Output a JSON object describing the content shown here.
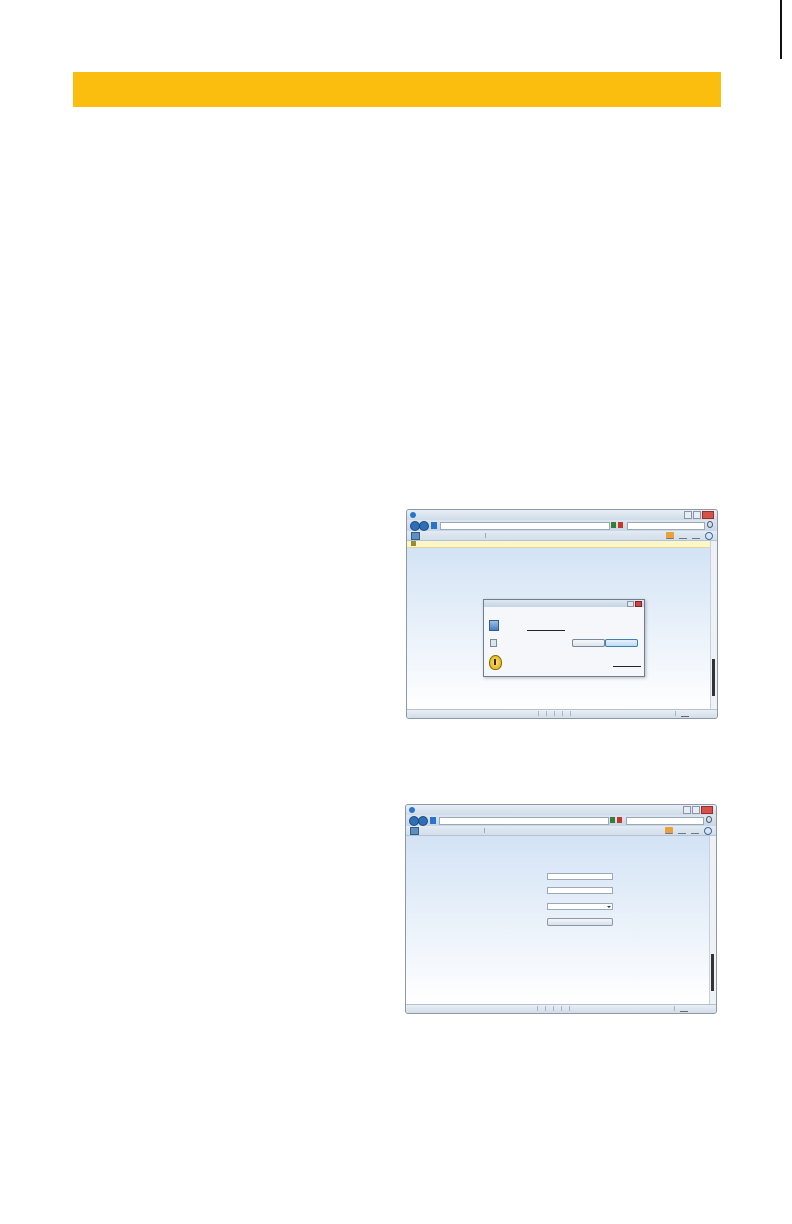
{
  "banner": {
    "color": "#fbbd0e"
  },
  "screenshots": [
    {
      "content": "file-download-dialog",
      "scroll_position": 0.9
    },
    {
      "content": "login-form",
      "scroll_position": 0.9
    }
  ],
  "icons": [
    "browser-logo-icon",
    "back-icon",
    "forward-icon",
    "search-icon",
    "home-icon",
    "tools-icon",
    "file-icon",
    "security-shield-icon"
  ]
}
